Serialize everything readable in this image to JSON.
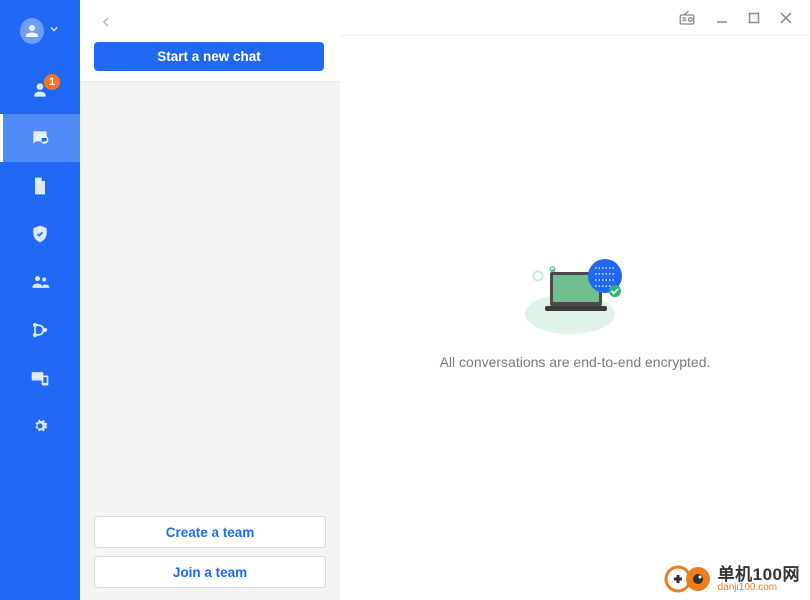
{
  "rail": {
    "badge_count": "1"
  },
  "col2": {
    "start_chat_label": "Start a new chat",
    "create_team_label": "Create a team",
    "join_team_label": "Join a team"
  },
  "main": {
    "empty_text": "All conversations are end-to-end encrypted."
  },
  "watermark": {
    "line1": "单机100网",
    "line2": "danji100.com"
  }
}
